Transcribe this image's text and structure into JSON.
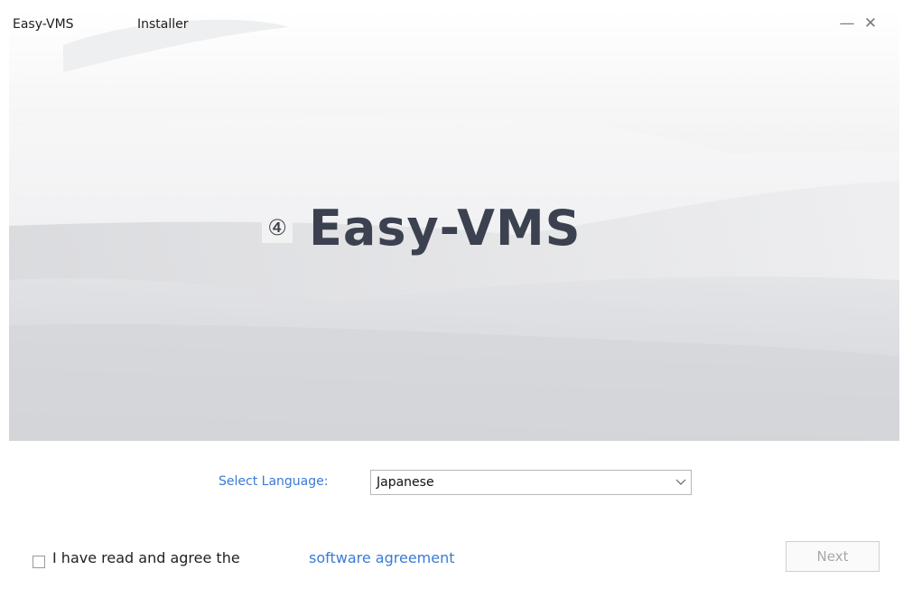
{
  "window": {
    "app_name": "Easy-VMS",
    "subtitle": "Installer",
    "minimize_glyph": "—",
    "close_glyph": "✕"
  },
  "hero": {
    "logo_mark": "④",
    "logo_text": "Easy-VMS"
  },
  "language": {
    "label": "Select Language:",
    "selected": "Japanese"
  },
  "agreement": {
    "text": "I have read and agree the",
    "link": "software agreement",
    "checked": false
  },
  "buttons": {
    "next": "Next"
  },
  "colors": {
    "link_blue": "#3a7bd5",
    "logo_gray": "#3c4150",
    "disabled_text": "#a8a8a8"
  }
}
